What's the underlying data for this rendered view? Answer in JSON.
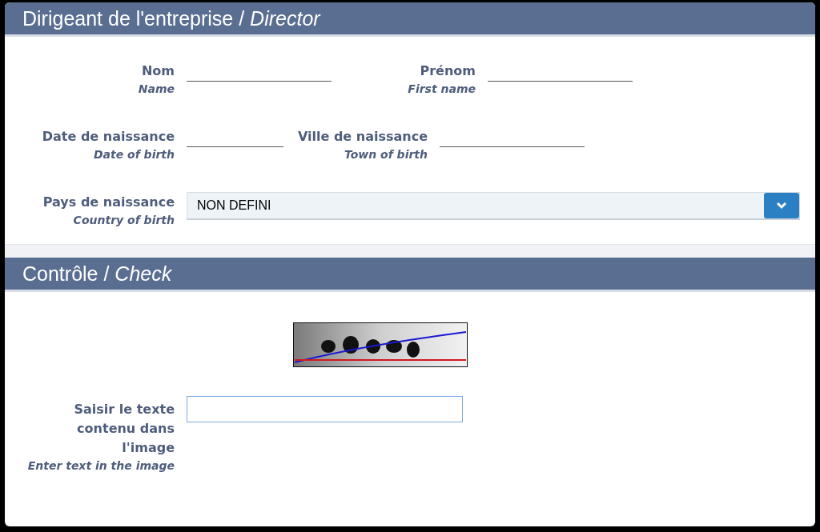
{
  "sections": [
    {
      "title": "Dirigeant de l'entreprise / *Director*",
      "rows": [
        {
          "fields": [
            {
              "kind": "text",
              "label": "Nom",
              "label_en": "Name"
            },
            {
              "kind": "text",
              "label": "Prénom",
              "label_en": "First name"
            }
          ]
        },
        {
          "fields": [
            {
              "kind": "date",
              "label": "Date de naissance",
              "label_en": "Date of birth"
            },
            {
              "kind": "text",
              "label": "Ville de naissance",
              "label_en": "Town of birth"
            }
          ]
        },
        {
          "fields": [
            {
              "kind": "select",
              "label": "Pays de naissance",
              "label_en": "Country of birth",
              "value": "NON DEFINI"
            }
          ]
        }
      ]
    },
    {
      "title": "Contrôle / *Check*",
      "rows": [
        {
          "fields": [
            {
              "kind": "captcha"
            }
          ]
        },
        {
          "fields": [
            {
              "kind": "input",
              "label": "Saisir le texte contenu dans l'image",
              "label_en": "Enter text in the image"
            }
          ]
        }
      ]
    }
  ]
}
